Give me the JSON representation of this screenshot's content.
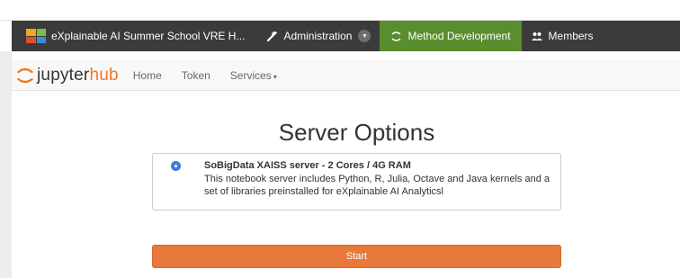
{
  "vre_bar": {
    "brand": "eXplainable AI Summer School VRE H...",
    "administration": "Administration",
    "method_development": "Method Development",
    "members": "Members"
  },
  "jupyterhub_nav": {
    "logo_jupyter": "jupyter",
    "logo_hub": "hub",
    "home": "Home",
    "token": "Token",
    "services": "Services"
  },
  "page": {
    "title": "Server Options"
  },
  "option": {
    "name": "SoBigData XAISS server - 2 Cores / 4G RAM",
    "description": "This notebook server includes Python, R, Julia, Octave and Java kernels and a set of libraries preinstalled for eXplainable AI Analyticsl",
    "selected": true
  },
  "start_button": "Start",
  "colors": {
    "vre_bar_bg": "#3b3b3b",
    "active_tab_bg": "#5a8d2e",
    "jupyter_orange": "#f37726",
    "start_button_bg": "#e8793a",
    "radio_blue": "#3b7dd8"
  }
}
